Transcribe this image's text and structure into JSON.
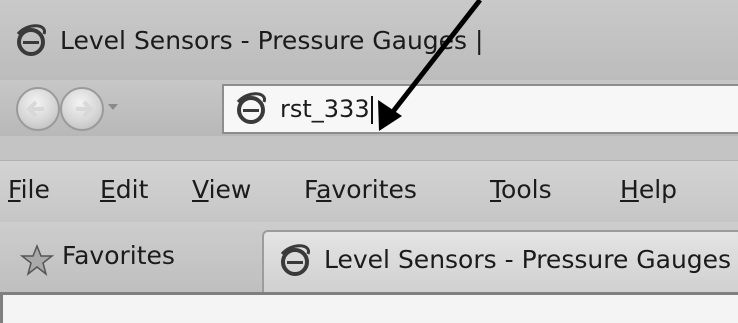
{
  "window": {
    "title": "Level Sensors - Pressure Gauges |"
  },
  "navigation": {
    "address_value": "rst_333"
  },
  "menu": {
    "items": [
      {
        "label": "File",
        "underline": "F",
        "rest": "ile"
      },
      {
        "label": "Edit",
        "underline": "E",
        "rest": "dit"
      },
      {
        "label": "View",
        "underline": "V",
        "rest": "iew"
      },
      {
        "label": "Favorites",
        "pre": "F",
        "underline": "a",
        "rest": "vorites"
      },
      {
        "label": "Tools",
        "underline": "T",
        "rest": "ools"
      },
      {
        "label": "Help",
        "underline": "H",
        "rest": "elp"
      }
    ]
  },
  "favorites_bar": {
    "favorites_label": "Favorites",
    "tab_label": "Level Sensors - Pressure Gauges"
  },
  "icons": {
    "title": "ie-logo-icon",
    "back": "back-arrow-icon",
    "forward": "forward-arrow-icon",
    "dropdown": "chevron-down-icon",
    "address": "ie-logo-icon",
    "favorites": "star-icon",
    "tab": "ie-logo-icon"
  }
}
